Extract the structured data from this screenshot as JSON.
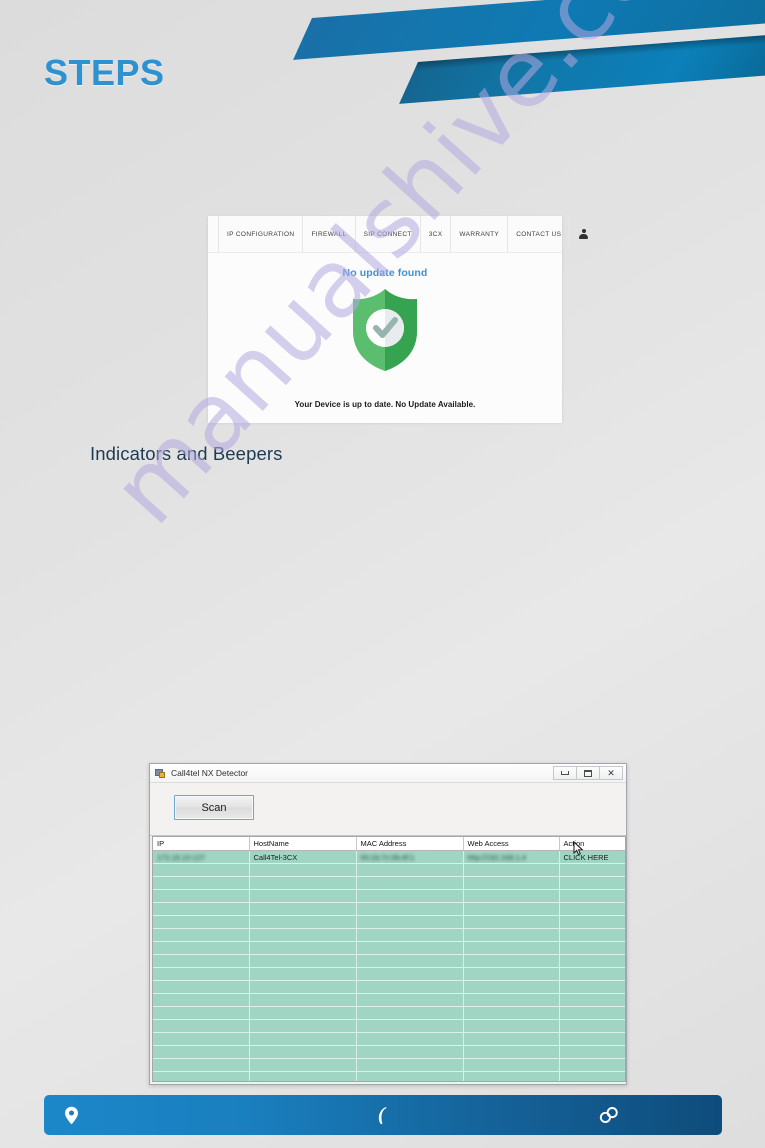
{
  "page": {
    "title": "STEPS",
    "background_color": "#dedede",
    "accent_color": "#2d92d0",
    "watermark": "manualshive.com"
  },
  "browser_card": {
    "nav_items": [
      {
        "label": "IP CONFIGURATION"
      },
      {
        "label": "FIREWALL"
      },
      {
        "label": "SIP CONNECT"
      },
      {
        "label": "3CX"
      },
      {
        "label": "WARRANTY"
      },
      {
        "label": "CONTACT US"
      }
    ],
    "account_icon": "person-icon",
    "status_title": "No update found",
    "status_title_color": "#3a93d6",
    "shield_icon": "shield-check-icon",
    "shield_color": "#4caf62",
    "status_message": "Your Device is up to date. No Update Available."
  },
  "section": {
    "heading": "Indicators and Beepers"
  },
  "detector": {
    "window_title": "Call4tel NX Detector",
    "app_icon": "application-icon",
    "window_buttons": [
      {
        "name": "minimize-button",
        "glyph": "minimize"
      },
      {
        "name": "maximize-button",
        "glyph": "maximize"
      },
      {
        "name": "close-button",
        "glyph": "✕"
      }
    ],
    "scan_button_label": "Scan",
    "table": {
      "columns": [
        "IP",
        "HostName",
        "MAC Address",
        "Web Access",
        "Action"
      ],
      "rows": [
        {
          "ip": "172.16.10.127",
          "hostname": "Call4Tel-3CX",
          "mac": "00:1b:7c:0b:4f:1",
          "web": "http://192.168.1.4",
          "action": "CLICK HERE",
          "blurred": [
            "ip",
            "mac",
            "web"
          ]
        }
      ],
      "empty_row_count": 17,
      "row_background": "#9fd5c2"
    }
  },
  "footer": {
    "items": [
      {
        "icon": "location-pin-icon",
        "label": ""
      },
      {
        "icon": "phone-icon",
        "label": ""
      },
      {
        "icon": "link-chain-icon",
        "label": ""
      }
    ],
    "background_color": "#1b87c9"
  }
}
